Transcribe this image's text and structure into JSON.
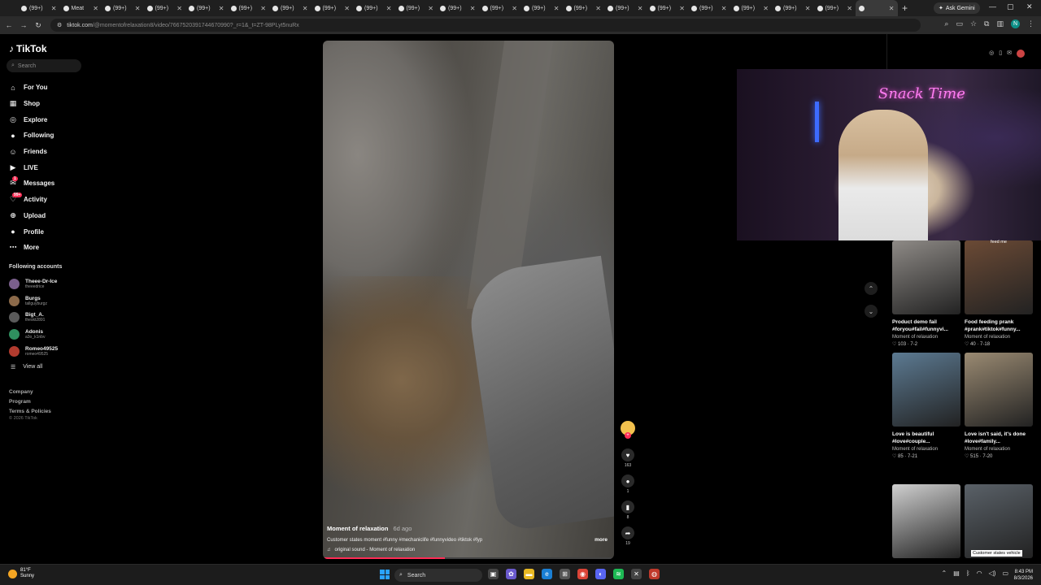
{
  "browser": {
    "tabs": [
      {
        "label": "(99+)",
        "active": false
      },
      {
        "label": "Meat",
        "active": false
      },
      {
        "label": "(99+)",
        "active": false
      },
      {
        "label": "(99+)",
        "active": false
      },
      {
        "label": "(99+)",
        "active": false
      },
      {
        "label": "(99+)",
        "active": false
      },
      {
        "label": "(99+)",
        "active": false
      },
      {
        "label": "(99+)",
        "active": false
      },
      {
        "label": "(99+)",
        "active": false
      },
      {
        "label": "(99+)",
        "active": false
      },
      {
        "label": "(99+)",
        "active": false
      },
      {
        "label": "(99+)",
        "active": false
      },
      {
        "label": "(99+)",
        "active": false
      },
      {
        "label": "(99+)",
        "active": false
      },
      {
        "label": "(99+)",
        "active": false
      },
      {
        "label": "(99+)",
        "active": false
      },
      {
        "label": "(99+)",
        "active": false
      },
      {
        "label": "(99+)",
        "active": false
      },
      {
        "label": "(99+)",
        "active": false
      },
      {
        "label": "(99+)",
        "active": false
      },
      {
        "label": "",
        "active": true
      }
    ],
    "ask_gemini": "Ask Gemini",
    "url_host": "tiktok.com",
    "url_path": "/@momentofrelaxation8/video/7667520391744670990?_r=1&_t=ZT-98PLyt5nuRx",
    "profile_initial": "N"
  },
  "sidebar": {
    "logo": "TikTok",
    "search_placeholder": "Search",
    "nav": [
      {
        "label": "For You",
        "icon": "home-icon"
      },
      {
        "label": "Shop",
        "icon": "shop-icon"
      },
      {
        "label": "Explore",
        "icon": "compass-icon"
      },
      {
        "label": "Following",
        "icon": "following-icon"
      },
      {
        "label": "Friends",
        "icon": "friends-icon"
      },
      {
        "label": "LIVE",
        "icon": "live-icon"
      },
      {
        "label": "Messages",
        "icon": "messages-icon",
        "badge": "1"
      },
      {
        "label": "Activity",
        "icon": "activity-icon",
        "badge": "99+"
      },
      {
        "label": "Upload",
        "icon": "upload-icon"
      },
      {
        "label": "Profile",
        "icon": "profile-icon"
      },
      {
        "label": "More",
        "icon": "more-icon"
      }
    ],
    "following_heading": "Following accounts",
    "accounts": [
      {
        "name": "Theee-Dr-Ice",
        "handle": "theeedrice"
      },
      {
        "name": "Burgs",
        "handle": "tallguyburgz"
      },
      {
        "name": "Bigt_A.",
        "handle": "theskt2891"
      },
      {
        "name": "Adonis",
        "handle": "a3o_k1nbv"
      },
      {
        "name": "Romeo49525",
        "handle": "romeo49525"
      }
    ],
    "view_all": "View all",
    "footer_links": [
      "Company",
      "Program",
      "Terms & Policies"
    ],
    "copyright": "© 2026 TikTok"
  },
  "video": {
    "author": "Moment of relaxation",
    "ago": "6d ago",
    "description": "Customer states moment #funny #mechaniclife #funnyvideo #tiktok #fyp",
    "sound": "original sound - Moment of relaxation",
    "more": "more",
    "progress": 0.42
  },
  "actions": {
    "likes": "163",
    "comments": "1",
    "saves": "8",
    "shares": "19"
  },
  "webcam": {
    "sign": "Snack Time"
  },
  "recommended": {
    "overlay_top": "feed me",
    "overlay_bottom": "Customer states vehicle",
    "items": [
      {
        "title": "Product demo fail #foryou#fail#funnyvi...",
        "author": "Moment of relaxation",
        "stats": "103 · 7-2",
        "color": "#8e8a86"
      },
      {
        "title": "Food feeding prank #prank#tiktok#funny...",
        "author": "Moment of relaxation",
        "stats": "40 · 7-18",
        "color": "#6b4a35"
      },
      {
        "title": "Love is beautiful #love#couple...",
        "author": "Moment of relaxation",
        "stats": "85 · 7-21",
        "color": "#5c7a92"
      },
      {
        "title": "Love isn't said, it's done #love#family...",
        "author": "Moment of relaxation",
        "stats": "515 · 7-20",
        "color": "#9a8a72"
      },
      {
        "title": "",
        "author": "",
        "stats": "",
        "color": "#cfcfcf"
      },
      {
        "title": "",
        "author": "",
        "stats": "",
        "color": "#5a6168"
      }
    ]
  },
  "taskbar": {
    "temp": "81°F",
    "weather": "Sunny",
    "search": "Search",
    "time": "8:43 PM",
    "date": "8/3/2026"
  },
  "colors": {
    "accent": "#fe2c55",
    "background": "#000000"
  }
}
